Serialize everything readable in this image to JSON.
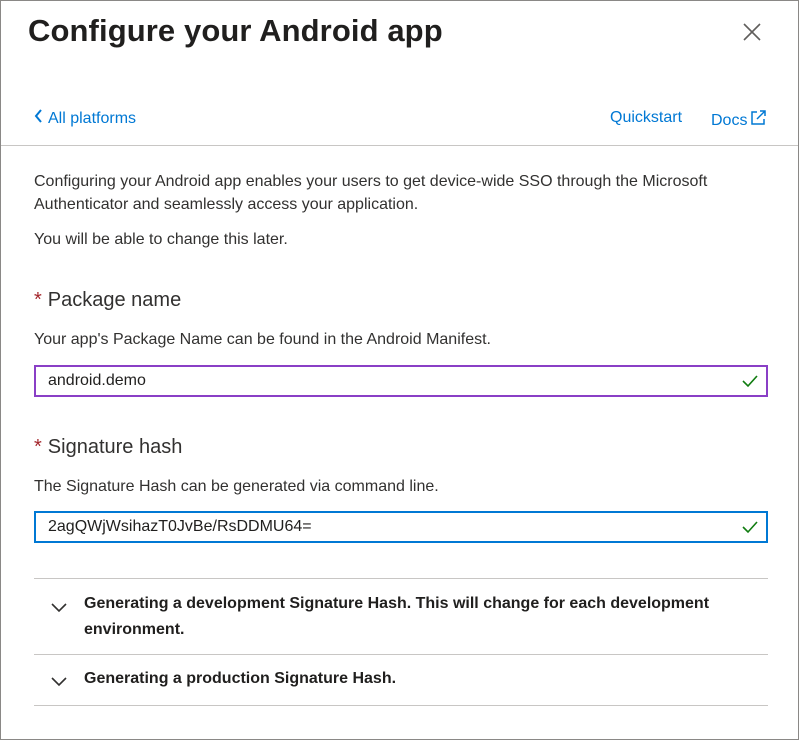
{
  "header": {
    "title": "Configure your Android app"
  },
  "nav": {
    "back_label": "All platforms",
    "quickstart_label": "Quickstart",
    "docs_label": "Docs"
  },
  "intro": {
    "description": "Configuring your Android app enables your users to get device-wide SSO through the Microsoft Authenticator and seamlessly access your application.",
    "change_later": "You will be able to change this later."
  },
  "package_name": {
    "required_marker": "*",
    "label": "Package name",
    "hint": "Your app's Package Name can be found in the Android Manifest.",
    "value": "android.demo",
    "valid": true
  },
  "signature_hash": {
    "required_marker": "*",
    "label": "Signature hash",
    "hint": "The Signature Hash can be generated via command line.",
    "value": "2agQWjWsihazT0JvBe/RsDDMU64=",
    "valid": true
  },
  "accordions": [
    {
      "title": "Generating a development Signature Hash. This will change for each development environment."
    },
    {
      "title": "Generating a production Signature Hash."
    }
  ],
  "colors": {
    "accent": "#0078d4",
    "required": "#a4262c",
    "valid_check": "#107c10",
    "package_field_border": "#8a3fc6"
  }
}
